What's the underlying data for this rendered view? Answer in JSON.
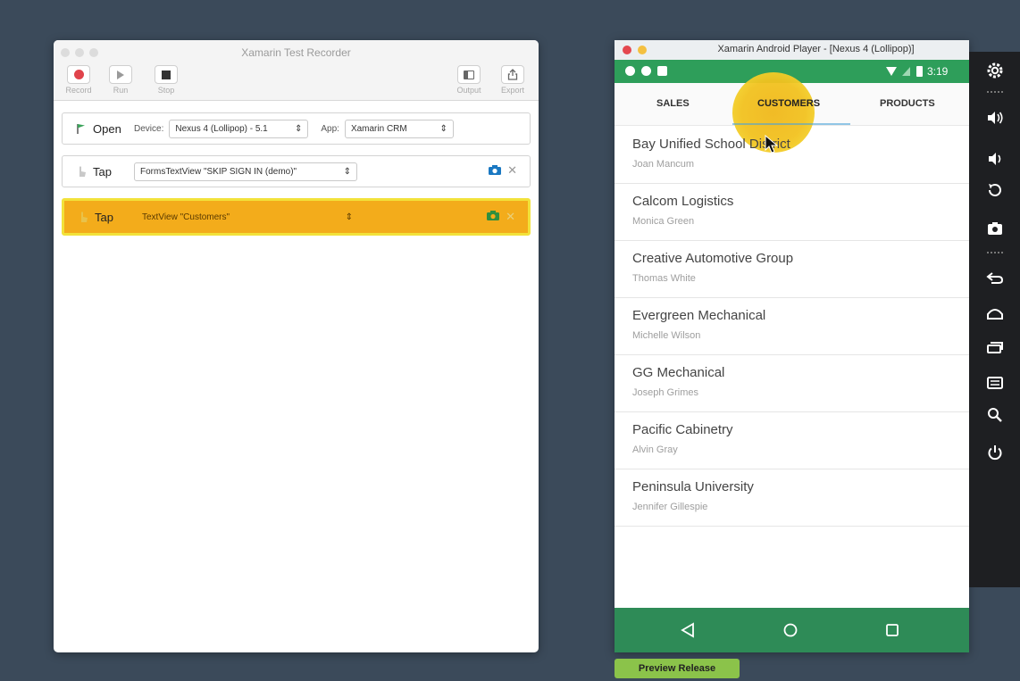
{
  "recorder": {
    "title": "Xamarin Test Recorder",
    "toolbar": {
      "record": "Record",
      "run": "Run",
      "stop": "Stop",
      "output": "Output",
      "export": "Export"
    },
    "steps": [
      {
        "action": "Open",
        "device_label": "Device:",
        "device_value": "Nexus 4 (Lollipop) - 5.1",
        "app_label": "App:",
        "app_value": "Xamarin CRM"
      },
      {
        "action": "Tap",
        "target": "FormsTextView \"SKIP SIGN IN (demo)\""
      },
      {
        "action": "Tap",
        "target": "TextView \"Customers\""
      }
    ],
    "colors": {
      "highlight": "#f3ac1b",
      "highlight_border": "#f2e23a",
      "record": "#e0434b",
      "camera": "#1a78c2"
    }
  },
  "android": {
    "title": "Xamarin Android Player - [Nexus 4 (Lollipop)]",
    "time": "3:19",
    "tabs": [
      "SALES",
      "CUSTOMERS",
      "PRODUCTS"
    ],
    "customers": [
      {
        "name": "Bay Unified School District",
        "contact": "Joan Mancum"
      },
      {
        "name": "Calcom Logistics",
        "contact": "Monica Green"
      },
      {
        "name": "Creative Automotive Group",
        "contact": "Thomas White"
      },
      {
        "name": "Evergreen Mechanical",
        "contact": "Michelle Wilson"
      },
      {
        "name": "GG Mechanical",
        "contact": "Joseph Grimes"
      },
      {
        "name": "Pacific Cabinetry",
        "contact": "Alvin Gray"
      },
      {
        "name": "Peninsula University",
        "contact": "Jennifer Gillespie"
      }
    ],
    "colors": {
      "status": "#2e9e5a",
      "nav": "#2e8b57"
    }
  },
  "preview_badge": "Preview Release"
}
